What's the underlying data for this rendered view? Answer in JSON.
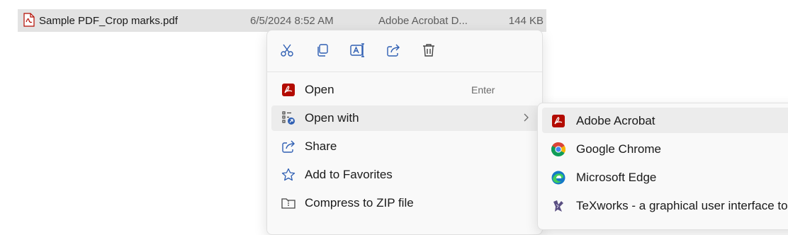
{
  "file": {
    "name": "Sample PDF_Crop marks.pdf",
    "date_modified": "6/5/2024 8:52 AM",
    "type": "Adobe Acrobat D...",
    "size": "144 KB",
    "icon": "pdf-file-icon"
  },
  "context_menu": {
    "toolbar": [
      {
        "name": "cut",
        "icon": "scissors-icon"
      },
      {
        "name": "copy",
        "icon": "copy-icon"
      },
      {
        "name": "rename",
        "icon": "rename-icon"
      },
      {
        "name": "share",
        "icon": "share-icon"
      },
      {
        "name": "delete",
        "icon": "trash-icon"
      }
    ],
    "items": [
      {
        "label": "Open",
        "shortcut": "Enter",
        "icon": "adobe-acrobat-icon"
      },
      {
        "label": "Open with",
        "icon": "open-with-icon",
        "has_submenu": true
      },
      {
        "label": "Share",
        "icon": "share-icon"
      },
      {
        "label": "Add to Favorites",
        "icon": "star-icon"
      },
      {
        "label": "Compress to ZIP file",
        "icon": "zip-folder-icon"
      }
    ]
  },
  "open_with_submenu": {
    "items": [
      {
        "label": "Adobe Acrobat",
        "icon": "adobe-acrobat-icon"
      },
      {
        "label": "Google Chrome",
        "icon": "chrome-icon"
      },
      {
        "label": "Microsoft Edge",
        "icon": "edge-icon"
      },
      {
        "label": "TeXworks - a graphical user interface to",
        "icon": "texworks-icon"
      }
    ]
  },
  "colors": {
    "accent": "#2f5fb3",
    "acrobat_red": "#b30b00",
    "selection": "#e3e3e3",
    "hover": "#ececec"
  }
}
